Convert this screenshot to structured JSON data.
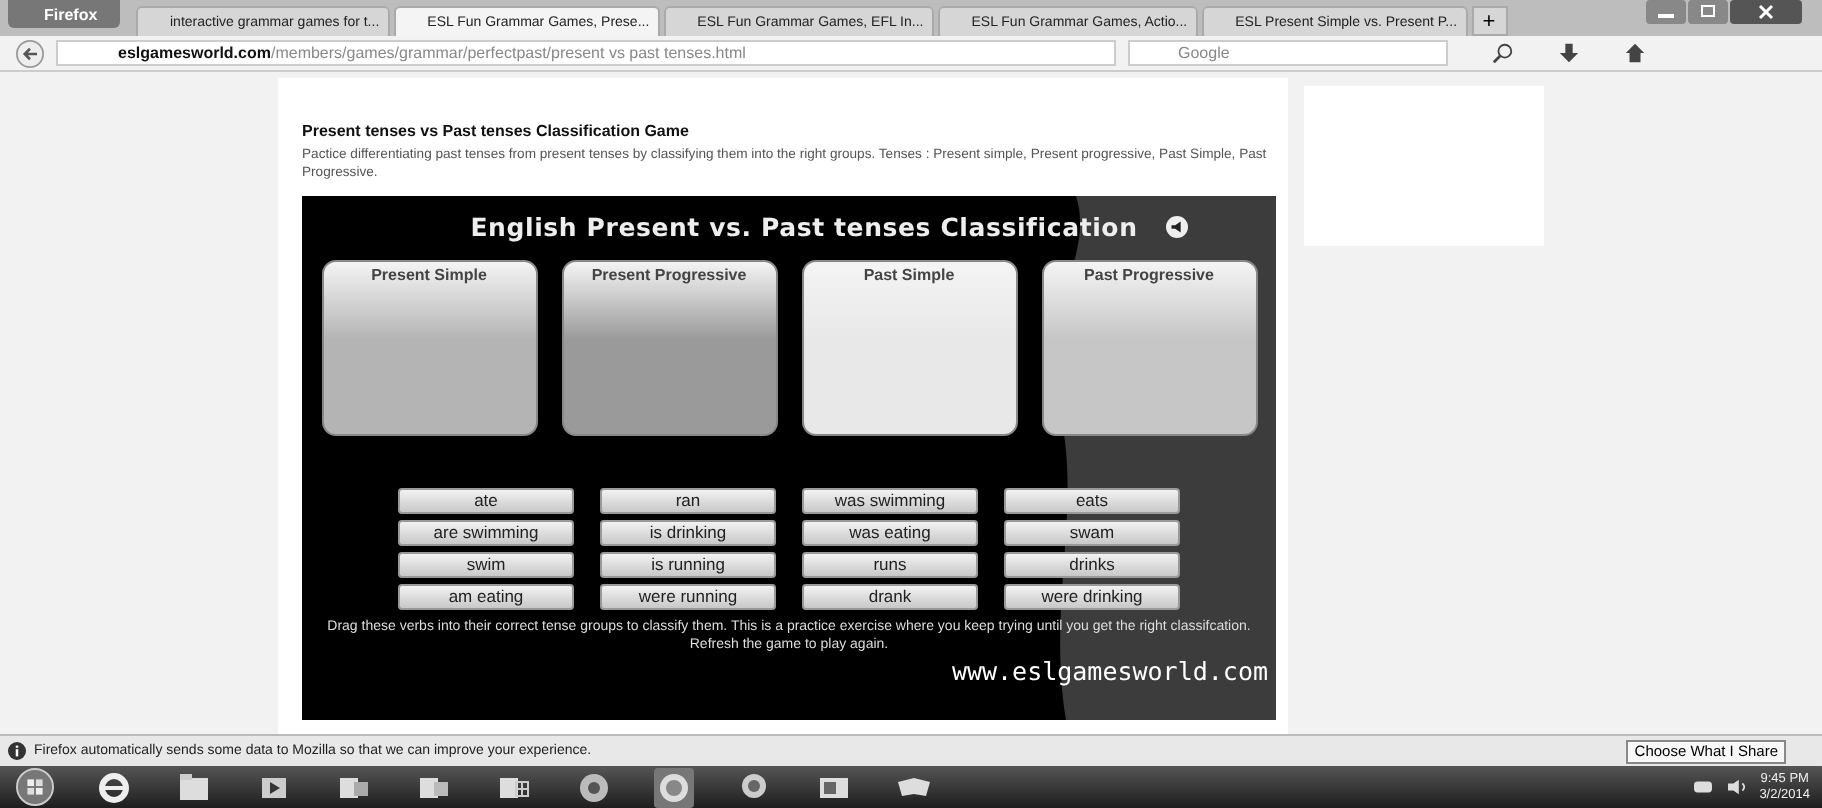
{
  "browser": {
    "menu_button": "Firefox",
    "tabs": [
      {
        "label": "interactive grammar games for t...",
        "selected": false
      },
      {
        "label": "ESL Fun Grammar Games, Prese...",
        "selected": true
      },
      {
        "label": "ESL Fun Grammar Games, EFL In...",
        "selected": false
      },
      {
        "label": "ESL Fun Grammar Games, Actio...",
        "selected": false
      },
      {
        "label": "ESL Present Simple vs. Present P...",
        "selected": false
      }
    ],
    "new_tab": "+",
    "url_host": "eslgamesworld.com",
    "url_path": "/members/games/grammar/perfectpast/present vs past tenses.html",
    "search_placeholder": "Google"
  },
  "page": {
    "heading": "Present tenses vs Past tenses Classification Game",
    "description": "Pactice differentiating past tenses from present tenses by classifying them into the right groups. Tenses : Present simple, Present progressive, Past Simple, Past Progressive."
  },
  "game": {
    "title": "English Present vs. Past tenses Classification",
    "groups": [
      {
        "label": "Present Simple",
        "color": "#b4b4b4"
      },
      {
        "label": "Present Progressive",
        "color": "#9a9a9a"
      },
      {
        "label": "Past Simple",
        "color": "#e8e8e8"
      },
      {
        "label": "Past Progressive",
        "color": "#c6c6c6"
      }
    ],
    "verbs": [
      "ate",
      "ran",
      "was swimming",
      "eats",
      "are swimming",
      "is drinking",
      "was eating",
      "swam",
      "swim",
      "is running",
      "runs",
      "drinks",
      "am eating",
      "were running",
      "drank",
      "were drinking"
    ],
    "instructions": "Drag these verbs into their correct tense groups to classify them. This is a practice exercise where you keep trying until you get the right classifcation. Refresh the game to play again.",
    "site": "www.eslgamesworld.com"
  },
  "notification": {
    "message": "Firefox automatically sends some data to Mozilla so that we can improve your experience.",
    "button": "Choose What I Share"
  },
  "taskbar": {
    "time": "9:45 PM",
    "date": "3/2/2014"
  }
}
